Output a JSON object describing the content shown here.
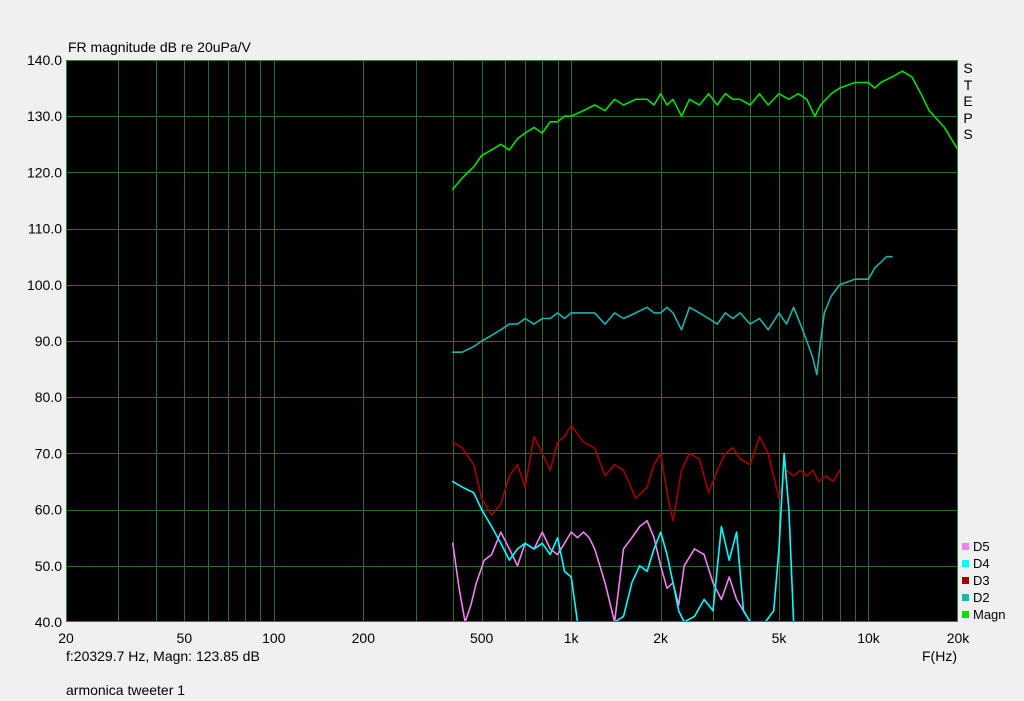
{
  "header": {
    "title": "FR magnitude dB re 20uPa/V"
  },
  "side_label": {
    "letters": [
      "S",
      "T",
      "E",
      "P",
      "S"
    ]
  },
  "status": {
    "readout": "f:20329.7 Hz, Magn: 123.85 dB",
    "x_unit": "F(Hz)",
    "footer": "armonica tweeter 1"
  },
  "legend": [
    {
      "name": "D5",
      "color": "#ee82ee"
    },
    {
      "name": "D4",
      "color": "#00ffff"
    },
    {
      "name": "D3",
      "color": "#a00000"
    },
    {
      "name": "D2",
      "color": "#20b2aa"
    },
    {
      "name": "Magn",
      "color": "#00e000"
    }
  ],
  "colors": {
    "plot_bg": "#000000",
    "grid": "#2e6b2e",
    "frame": "#3a7a3a"
  },
  "chart_data": {
    "type": "line",
    "title": "FR magnitude dB re 20uPa/V",
    "xlabel": "F(Hz)",
    "xscale": "log",
    "xlim": [
      20,
      20000
    ],
    "ylim": [
      40,
      140
    ],
    "grid": true,
    "legend_position": "bottom-right",
    "x_ticks": [
      {
        "value": 20,
        "label": "20"
      },
      {
        "value": 50,
        "label": "50"
      },
      {
        "value": 100,
        "label": "100"
      },
      {
        "value": 200,
        "label": "200"
      },
      {
        "value": 500,
        "label": "500"
      },
      {
        "value": 1000,
        "label": "1k"
      },
      {
        "value": 2000,
        "label": "2k"
      },
      {
        "value": 5000,
        "label": "5k"
      },
      {
        "value": 10000,
        "label": "10k"
      },
      {
        "value": 20000,
        "label": "20k"
      }
    ],
    "y_ticks": [
      {
        "value": 40,
        "label": "40.0"
      },
      {
        "value": 50,
        "label": "50.0"
      },
      {
        "value": 60,
        "label": "60.0"
      },
      {
        "value": 70,
        "label": "70.0"
      },
      {
        "value": 80,
        "label": "80.0"
      },
      {
        "value": 90,
        "label": "90.0"
      },
      {
        "value": 100,
        "label": "100.0"
      },
      {
        "value": 110,
        "label": "110.0"
      },
      {
        "value": 120,
        "label": "120.0"
      },
      {
        "value": 130,
        "label": "130.0"
      },
      {
        "value": 140,
        "label": "140.0"
      }
    ],
    "series": [
      {
        "name": "Magn",
        "color": "#00e000",
        "x": [
          400,
          430,
          470,
          500,
          540,
          580,
          620,
          660,
          700,
          750,
          800,
          850,
          900,
          950,
          1000,
          1100,
          1200,
          1300,
          1400,
          1500,
          1650,
          1800,
          1900,
          2000,
          2100,
          2200,
          2350,
          2500,
          2700,
          2900,
          3100,
          3300,
          3500,
          3700,
          4000,
          4300,
          4600,
          5000,
          5400,
          5800,
          6200,
          6600,
          6900,
          7500,
          8000,
          9000,
          10000,
          10500,
          11000,
          12000,
          13000,
          14000,
          15000,
          16000,
          18000,
          20000
        ],
        "y": [
          117,
          119,
          121,
          123,
          124,
          125,
          124,
          126,
          127,
          128,
          127,
          129,
          129,
          130,
          130,
          131,
          132,
          131,
          133,
          132,
          133,
          133,
          132,
          134,
          132,
          133,
          130,
          133,
          132,
          134,
          132,
          134,
          133,
          133,
          132,
          134,
          132,
          134,
          133,
          134,
          133,
          130,
          132,
          134,
          135,
          136,
          136,
          135,
          136,
          137,
          138,
          137,
          134,
          131,
          128,
          124
        ]
      },
      {
        "name": "D2",
        "color": "#20b2aa",
        "x": [
          400,
          430,
          470,
          500,
          540,
          580,
          620,
          660,
          700,
          750,
          800,
          850,
          900,
          950,
          1000,
          1100,
          1200,
          1300,
          1400,
          1500,
          1650,
          1800,
          1900,
          2000,
          2100,
          2200,
          2350,
          2500,
          2700,
          2900,
          3100,
          3300,
          3500,
          3700,
          4000,
          4300,
          4600,
          5000,
          5300,
          5600,
          5900,
          6200,
          6500,
          6700,
          6900,
          7100,
          7500,
          8000,
          9000,
          10000,
          10500,
          11000,
          11500,
          12000
        ],
        "y": [
          88,
          88,
          89,
          90,
          91,
          92,
          93,
          93,
          94,
          93,
          94,
          94,
          95,
          94,
          95,
          95,
          95,
          93,
          95,
          94,
          95,
          96,
          95,
          95,
          96,
          95,
          92,
          96,
          95,
          94,
          93,
          95,
          94,
          95,
          93,
          94,
          92,
          95,
          93,
          96,
          93,
          90,
          87,
          84,
          90,
          95,
          98,
          100,
          101,
          101,
          103,
          104,
          105,
          105
        ]
      },
      {
        "name": "D3",
        "color": "#a00000",
        "x": [
          400,
          430,
          470,
          500,
          540,
          580,
          620,
          660,
          700,
          750,
          800,
          850,
          900,
          950,
          1000,
          1100,
          1200,
          1300,
          1400,
          1500,
          1650,
          1800,
          1900,
          2000,
          2100,
          2200,
          2350,
          2500,
          2700,
          2900,
          3100,
          3300,
          3500,
          3700,
          4000,
          4300,
          4600,
          5000,
          5300,
          5600,
          5900,
          6200,
          6500,
          6800,
          7200,
          7600,
          8000
        ],
        "y": [
          72,
          71,
          68,
          62,
          59,
          61,
          66,
          68,
          64,
          73,
          70,
          67,
          72,
          73,
          75,
          72,
          71,
          66,
          68,
          67,
          62,
          64,
          68,
          70,
          63,
          58,
          67,
          70,
          69,
          63,
          67,
          70,
          71,
          69,
          68,
          73,
          70,
          62,
          67,
          66,
          67,
          66,
          67,
          65,
          66,
          65,
          67
        ]
      },
      {
        "name": "D4",
        "color": "#00ffff",
        "x": [
          400,
          430,
          470,
          500,
          540,
          580,
          620,
          660,
          700,
          750,
          800,
          850,
          900,
          950,
          1000,
          1050,
          1100,
          1150,
          1200,
          1300,
          1400,
          1500,
          1600,
          1700,
          1800,
          1900,
          2000,
          2100,
          2200,
          2300,
          2400,
          2600,
          2800,
          3000,
          3200,
          3400,
          3600,
          3800,
          4000,
          4200,
          4500,
          4800,
          5000,
          5200,
          5400,
          5600
        ],
        "y": [
          65,
          64,
          63,
          60,
          57,
          54,
          51,
          53,
          54,
          53,
          54,
          52,
          55,
          49,
          48,
          40,
          40,
          40,
          40,
          40,
          40,
          41,
          47,
          50,
          49,
          53,
          56,
          52,
          47,
          42,
          40,
          41,
          44,
          42,
          57,
          51,
          56,
          42,
          40,
          40,
          40,
          42,
          53,
          70,
          60,
          40
        ]
      },
      {
        "name": "D5",
        "color": "#ee82ee",
        "x": [
          400,
          420,
          440,
          460,
          480,
          510,
          540,
          580,
          620,
          660,
          700,
          750,
          800,
          850,
          900,
          950,
          1000,
          1050,
          1100,
          1150,
          1200,
          1300,
          1400,
          1500,
          1600,
          1700,
          1800,
          1900,
          2000,
          2100,
          2200,
          2300,
          2400,
          2600,
          2800,
          3000,
          3200,
          3400,
          3600,
          3800,
          4000
        ],
        "y": [
          54,
          46,
          40,
          43,
          47,
          51,
          52,
          56,
          53,
          50,
          54,
          53,
          56,
          53,
          52,
          54,
          56,
          55,
          56,
          55,
          53,
          47,
          40,
          53,
          55,
          57,
          58,
          55,
          50,
          46,
          47,
          43,
          50,
          53,
          52,
          47,
          44,
          48,
          44,
          42,
          40
        ]
      }
    ]
  }
}
